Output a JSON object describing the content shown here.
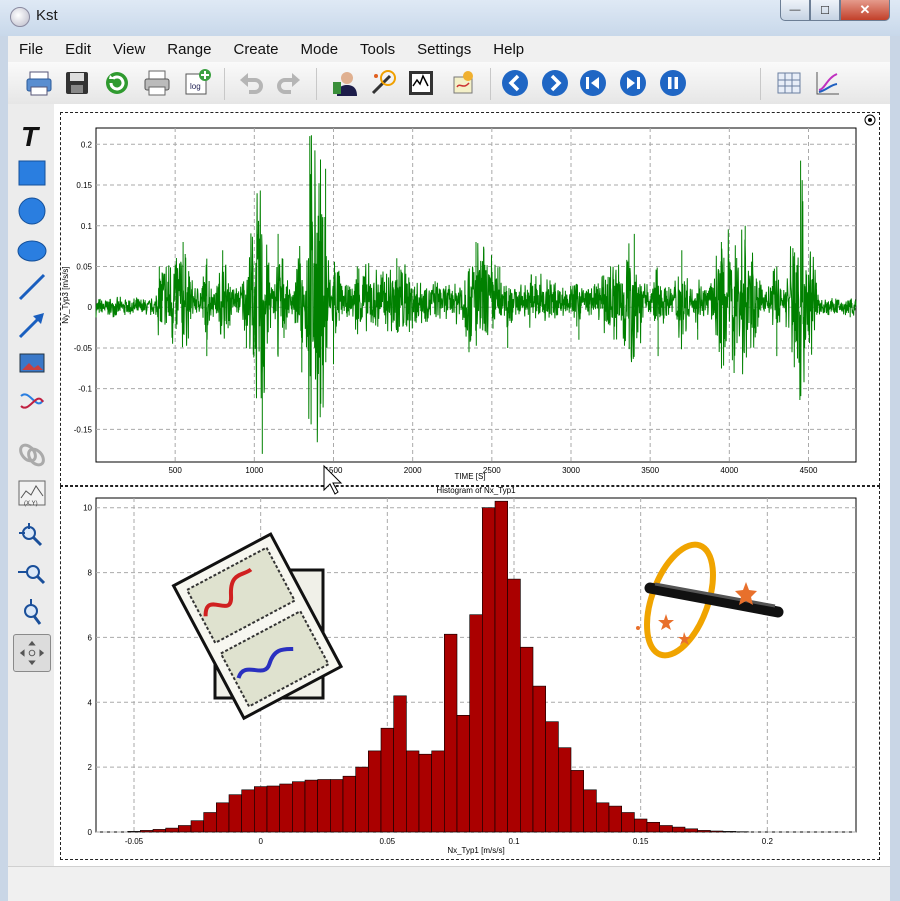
{
  "window": {
    "title": "Kst",
    "minimize": "—",
    "maximize": "☐",
    "close": "✕"
  },
  "menu": [
    "File",
    "Edit",
    "View",
    "Range",
    "Create",
    "Mode",
    "Tools",
    "Settings",
    "Help"
  ],
  "toolbar": {
    "icons": [
      "print-icon",
      "save-icon",
      "reload-icon",
      "export-icon",
      "log-icon",
      "undo-icon",
      "redo-icon",
      "data-manager-icon",
      "data-wizard-icon",
      "plot-icon",
      "theme-icon",
      "back-icon",
      "forward-icon",
      "skip-back-icon",
      "skip-forward-icon",
      "pause-icon",
      "layout-grid-icon",
      "curve-icon"
    ]
  },
  "sidebar": {
    "icons": [
      "text-tool-icon",
      "rectangle-tool-icon",
      "circle-tool-icon",
      "ellipse-tool-icon",
      "line-tool-icon",
      "arrow-tool-icon",
      "picture-tool-icon",
      "shared-axis-icon",
      "link-icon",
      "zoom-tool-icon",
      "xy-zoom-icon",
      "x-zoom-icon",
      "y-zoom-icon",
      "layout-mode-icon"
    ]
  },
  "top_chart": {
    "ylabel": "Ny_Typ3 [m/s/s]",
    "xlabel": "TIME [S]",
    "y_ticks": [
      "0.2",
      "0.15",
      "0.1",
      "0.05",
      "0",
      "-0.05",
      "-0.1",
      "-0.15"
    ],
    "x_ticks": [
      "500",
      "1000",
      "1500",
      "2000",
      "2500",
      "3000",
      "3500",
      "4000",
      "4500"
    ],
    "line_color": "#008000"
  },
  "bottom_chart": {
    "title": "Histogram of Nx_Typ1",
    "xlabel": "Nx_Typ1 [m/s/s]",
    "y_ticks": [
      "10",
      "8",
      "6",
      "4",
      "2",
      "0"
    ],
    "x_ticks": [
      "-0.05",
      "0",
      "0.05",
      "0.1",
      "0.15",
      "0.2"
    ],
    "bar_color": "#aa0000"
  },
  "chart_data": [
    {
      "type": "line",
      "title": "",
      "xlabel": "TIME [S]",
      "ylabel": "Ny_Typ3 [m/s/s]",
      "xlim": [
        0,
        4800
      ],
      "ylim": [
        -0.19,
        0.22
      ],
      "grid": true,
      "series": [
        {
          "color": "#008000",
          "x": [
            0,
            150,
            250,
            350,
            400,
            550,
            700,
            800,
            950,
            1050,
            1150,
            1300,
            1350,
            1450,
            1500,
            1650,
            1800,
            1900,
            2050,
            2250,
            2400,
            2550,
            2600,
            2750,
            2900,
            3050,
            3150,
            3250,
            3400,
            3550,
            3700,
            3800,
            3950,
            4100,
            4300,
            4450,
            4550,
            4700,
            4800
          ],
          "y": [
            0.0,
            0.0,
            0.0,
            0.0,
            0.05,
            0.08,
            -0.06,
            0.07,
            -0.05,
            -0.18,
            0.09,
            -0.08,
            0.21,
            0.17,
            -0.07,
            0.05,
            0.04,
            0.06,
            0.03,
            0.02,
            0.08,
            0.05,
            -0.05,
            0.04,
            0.03,
            -0.04,
            0.02,
            0.05,
            0.09,
            -0.06,
            0.07,
            -0.04,
            0.08,
            0.1,
            -0.06,
            0.18,
            0.03,
            0.0,
            0.0
          ]
        }
      ]
    },
    {
      "type": "bar",
      "title": "Histogram of Nx_Typ1",
      "xlabel": "Nx_Typ1 [m/s/s]",
      "ylabel": "",
      "xlim": [
        -0.065,
        0.235
      ],
      "ylim": [
        0,
        10.3
      ],
      "grid": true,
      "bin_width": 0.005,
      "x": [
        -0.05,
        -0.045,
        -0.04,
        -0.035,
        -0.03,
        -0.025,
        -0.02,
        -0.015,
        -0.01,
        -0.005,
        0.0,
        0.005,
        0.01,
        0.015,
        0.02,
        0.025,
        0.03,
        0.035,
        0.04,
        0.045,
        0.05,
        0.055,
        0.06,
        0.065,
        0.07,
        0.075,
        0.08,
        0.085,
        0.09,
        0.095,
        0.1,
        0.105,
        0.11,
        0.115,
        0.12,
        0.125,
        0.13,
        0.135,
        0.14,
        0.145,
        0.15,
        0.155,
        0.16,
        0.165,
        0.17,
        0.175,
        0.18,
        0.185,
        0.19
      ],
      "values": [
        0.02,
        0.05,
        0.08,
        0.12,
        0.2,
        0.35,
        0.6,
        0.9,
        1.15,
        1.3,
        1.4,
        1.42,
        1.48,
        1.55,
        1.6,
        1.62,
        1.62,
        1.72,
        2.0,
        2.5,
        3.2,
        4.2,
        2.5,
        2.4,
        2.5,
        6.1,
        3.6,
        6.7,
        10.0,
        10.2,
        7.8,
        5.7,
        4.5,
        3.4,
        2.6,
        1.9,
        1.3,
        0.9,
        0.8,
        0.6,
        0.4,
        0.3,
        0.2,
        0.15,
        0.1,
        0.05,
        0.03,
        0.02,
        0.01
      ]
    }
  ]
}
